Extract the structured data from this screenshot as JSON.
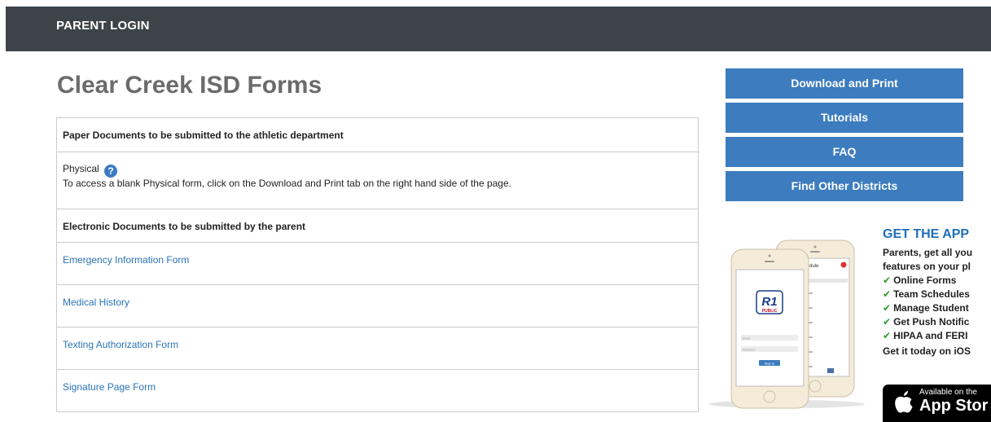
{
  "header": {
    "title": "PARENT LOGIN"
  },
  "page": {
    "title": "Clear Creek ISD Forms"
  },
  "forms": {
    "paper_header": "Paper Documents to be submitted to the athletic department",
    "physical_label": "Physical",
    "physical_help_icon": "help-icon",
    "physical_text": "To access a blank Physical form, click on the Download and Print tab on the right hand side of the page.",
    "electronic_header": "Electronic Documents to be submitted by the parent",
    "links": [
      "Emergency Information Form",
      "Medical History",
      "Texting Authorization Form",
      "Signature Page Form"
    ]
  },
  "sidebar": {
    "buttons": [
      "Download and Print",
      "Tutorials",
      "FAQ",
      "Find Other Districts"
    ],
    "button_color": "#3c7cbf"
  },
  "app": {
    "heading": "GET THE APP",
    "intro_line1": "Parents, get all you",
    "intro_line2": "features on your pl",
    "features": [
      "Online Forms",
      "Team Schedules",
      "Manage Student",
      "Get Push Notific",
      "HIPAA and FERI"
    ],
    "get_it": "Get it today on iOS",
    "appstore_small": "Available on the",
    "appstore_big": "App Stor",
    "phone_logo_text": "R1",
    "phone_logo_sub": "PUBLIC",
    "phone_field_1": "Email",
    "phone_field_2": "Password",
    "phone_button": "Sign In",
    "phone_schedule_title": "Team Schedule",
    "accent_color": "#1f6fb8"
  }
}
